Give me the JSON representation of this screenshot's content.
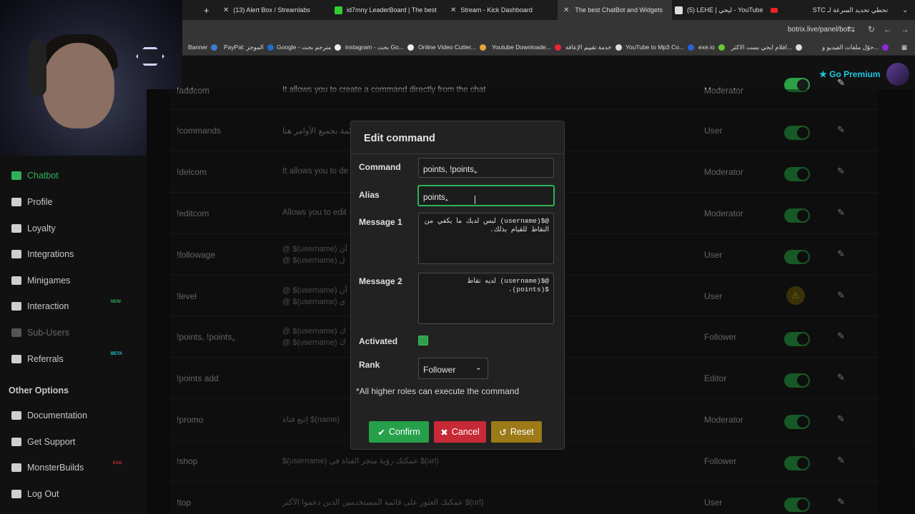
{
  "browser": {
    "tabs": [
      {
        "title": "(13) Alert Box / Streamlabs",
        "fav": "#2aa"
      },
      {
        "title": "id7mny LeaderBoard | The best",
        "fav": "#3c3"
      },
      {
        "title": "Stream - Kick Dashboard",
        "fav": "#ddd"
      },
      {
        "title": "The best ChatBot and Widgets",
        "fav": "#3c3"
      },
      {
        "title": "(5) LEHE | ليحي - YouTube",
        "fav": "#ddd"
      },
      {
        "title": "تحطي تحديد السرعة لـ STC",
        "fav": "#e22"
      }
    ],
    "new_tab": "+",
    "url": "botrix.live/panel/bot",
    "bookmarks": [
      "Banner",
      "PayPal: الموجز",
      "Google - مترجم بحث",
      "instagram - بحث Go...",
      "Online Video Cutter...",
      "Youtube Downloade...",
      "خدمة تقييم الإعاقة",
      "YouTube to Mp3 Co...",
      "exe.io",
      "افلام ايجي بست الاكثر...",
      "حوّل ملفات الفيديو و..."
    ]
  },
  "header": {
    "go_premium": "Go Premium"
  },
  "sidebar": {
    "items": [
      {
        "label": "Chatbot",
        "state": "active"
      },
      {
        "label": "Profile",
        "state": ""
      },
      {
        "label": "Loyalty",
        "state": ""
      },
      {
        "label": "Integrations",
        "state": ""
      },
      {
        "label": "Minigames",
        "state": ""
      },
      {
        "label": "Interaction",
        "state": "",
        "badge": "NEW"
      },
      {
        "label": "Sub-Users",
        "state": "dim"
      },
      {
        "label": "Referrals",
        "state": "",
        "badge": "BETA"
      }
    ],
    "other_heading": "Other Options",
    "other_items": [
      {
        "label": "Documentation"
      },
      {
        "label": "Get Support"
      },
      {
        "label": "MonsterBuilds",
        "badge": "EAD"
      },
      {
        "label": "Log Out"
      }
    ]
  },
  "commands": [
    {
      "name": "!addcom",
      "desc": "It allows you to create a command directly from the chat",
      "desc2": "",
      "rank": "Moderator",
      "status": "on"
    },
    {
      "name": "!commands",
      "desc": "قائمة بجميع الأوامر هنا",
      "desc2": "",
      "rank": "User",
      "status": "on"
    },
    {
      "name": "!delcom",
      "desc": "It allows you to de",
      "desc2": "",
      "rank": "Moderator",
      "status": "on"
    },
    {
      "name": "!editcom",
      "desc": "Allows you to edit",
      "desc2": "",
      "rank": "Moderator",
      "status": "on"
    },
    {
      "name": "!followage",
      "desc": "@ $(username) آن",
      "desc2": "@ $(username) ل",
      "rank": "User",
      "status": "on"
    },
    {
      "name": "!level",
      "desc": "@ $(username) آن",
      "desc2": "@ $(username) ى",
      "rank": "User",
      "status": "warn"
    },
    {
      "name": "!points, !points,ِ",
      "desc": "@ $(username) ك",
      "desc2": "@ $(username) ك",
      "rank": "Follower",
      "status": "on"
    },
    {
      "name": "!points add",
      "desc": "",
      "desc2": "",
      "rank": "Editor",
      "status": "on"
    },
    {
      "name": "!promo",
      "desc": "إتبع قناة $(name)",
      "desc2": "",
      "rank": "Moderator",
      "status": "on"
    },
    {
      "name": "!shop",
      "desc": "$(username) عمكنك رؤية متجر القناة في $(url)",
      "desc2": "",
      "rank": "Follower",
      "status": "on"
    },
    {
      "name": "!top",
      "desc": "عمكنك العثور على قائمة المستخدمين الذين دعموا الأكثر $(url)",
      "desc2": "",
      "rank": "User",
      "status": "on"
    }
  ],
  "modal": {
    "title": "Edit command",
    "command_label": "Command",
    "command_value": "points, !points,ِ",
    "alias_label": "Alias",
    "alias_value": "points,ِ",
    "message1_label": "Message 1",
    "message1_value": "@$(username) ليس لديك ما يكفي من النقاط للقيام بذلك.",
    "message2_label": "Message 2",
    "message2_value": "@$(username) لديه نقاط $(points).",
    "activated_label": "Activated",
    "activated": true,
    "rank_label": "Rank",
    "rank_value": "Follower",
    "hint": "*All higher roles can execute the command",
    "confirm_label": "Confirm",
    "cancel_label": "Cancel",
    "reset_label": "Reset"
  },
  "colors": {
    "accent_green": "#2fb15a",
    "danger_red": "#c62a36",
    "reset_gold": "#9c7a18",
    "premium_cyan": "#1fc5e0"
  }
}
